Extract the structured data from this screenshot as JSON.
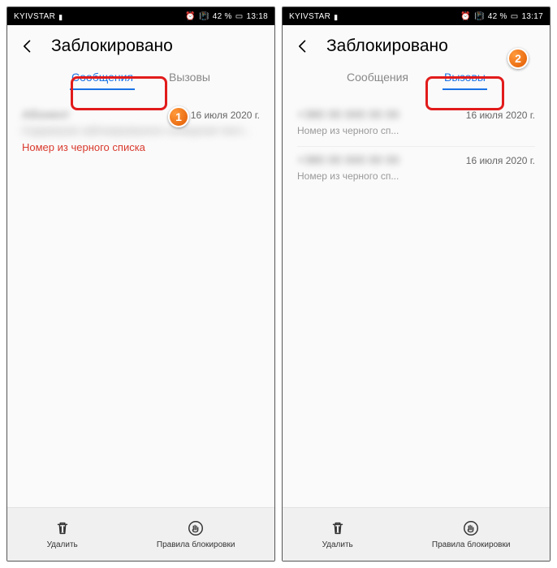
{
  "left": {
    "status": {
      "carrier": "KYIVSTAR",
      "alarm": "⏰",
      "battery": "42 %",
      "time": "13:18"
    },
    "header": {
      "title": "Заблокировано"
    },
    "tabs": {
      "messages": "Сообщения",
      "calls": "Вызовы",
      "active": "messages"
    },
    "items": [
      {
        "title": "Абонент",
        "sub": "Содержание заблокированного сообщения текст...",
        "date": "16 июля 2020 г.",
        "blacklist": "Номер из черного списка"
      }
    ],
    "bottom": {
      "delete": "Удалить",
      "rules": "Правила блокировки"
    },
    "badge": "1"
  },
  "right": {
    "status": {
      "carrier": "KYIVSTAR",
      "alarm": "⏰",
      "battery": "42 %",
      "time": "13:17"
    },
    "header": {
      "title": "Заблокировано"
    },
    "tabs": {
      "messages": "Сообщения",
      "calls": "Вызовы",
      "active": "calls"
    },
    "items": [
      {
        "title": "+380 00 000 00 00",
        "date": "16 июля 2020 г.",
        "sub": "Номер из черного сп..."
      },
      {
        "title": "+380 00 000 00 00",
        "date": "16 июля 2020 г.",
        "sub": "Номер из черного сп..."
      }
    ],
    "bottom": {
      "delete": "Удалить",
      "rules": "Правила блокировки"
    },
    "badge": "2"
  }
}
